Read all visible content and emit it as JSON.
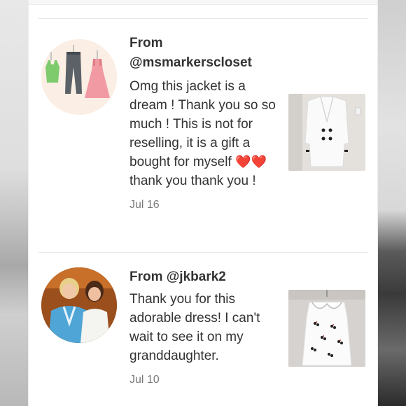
{
  "feedback": [
    {
      "from_label": "From",
      "username": "@msmarkerscloset",
      "message_before_hearts": "Omg this jacket is a dream ! Thank you so so much ! This is not for reselling, it is a gift a bought for myself",
      "hearts": "❤️❤️",
      "message_after_hearts": "thank you thank you !",
      "date": "Jul 16",
      "avatar_icon": "clothes-hanger-illustration-icon",
      "thumbnail_icon": "white-double-breasted-jacket-photo"
    },
    {
      "from_label": "From",
      "username": "@jkbark2",
      "message": "Thank you for this adorable dress! I can't wait to see it on my granddaughter.",
      "date": "Jul 10",
      "avatar_icon": "two-women-photo",
      "thumbnail_icon": "white-printed-dress-photo"
    }
  ],
  "colors": {
    "text": "#333333",
    "date": "#7a7a7a",
    "divider": "#e6e6e6",
    "heart": "#d92b2b"
  }
}
